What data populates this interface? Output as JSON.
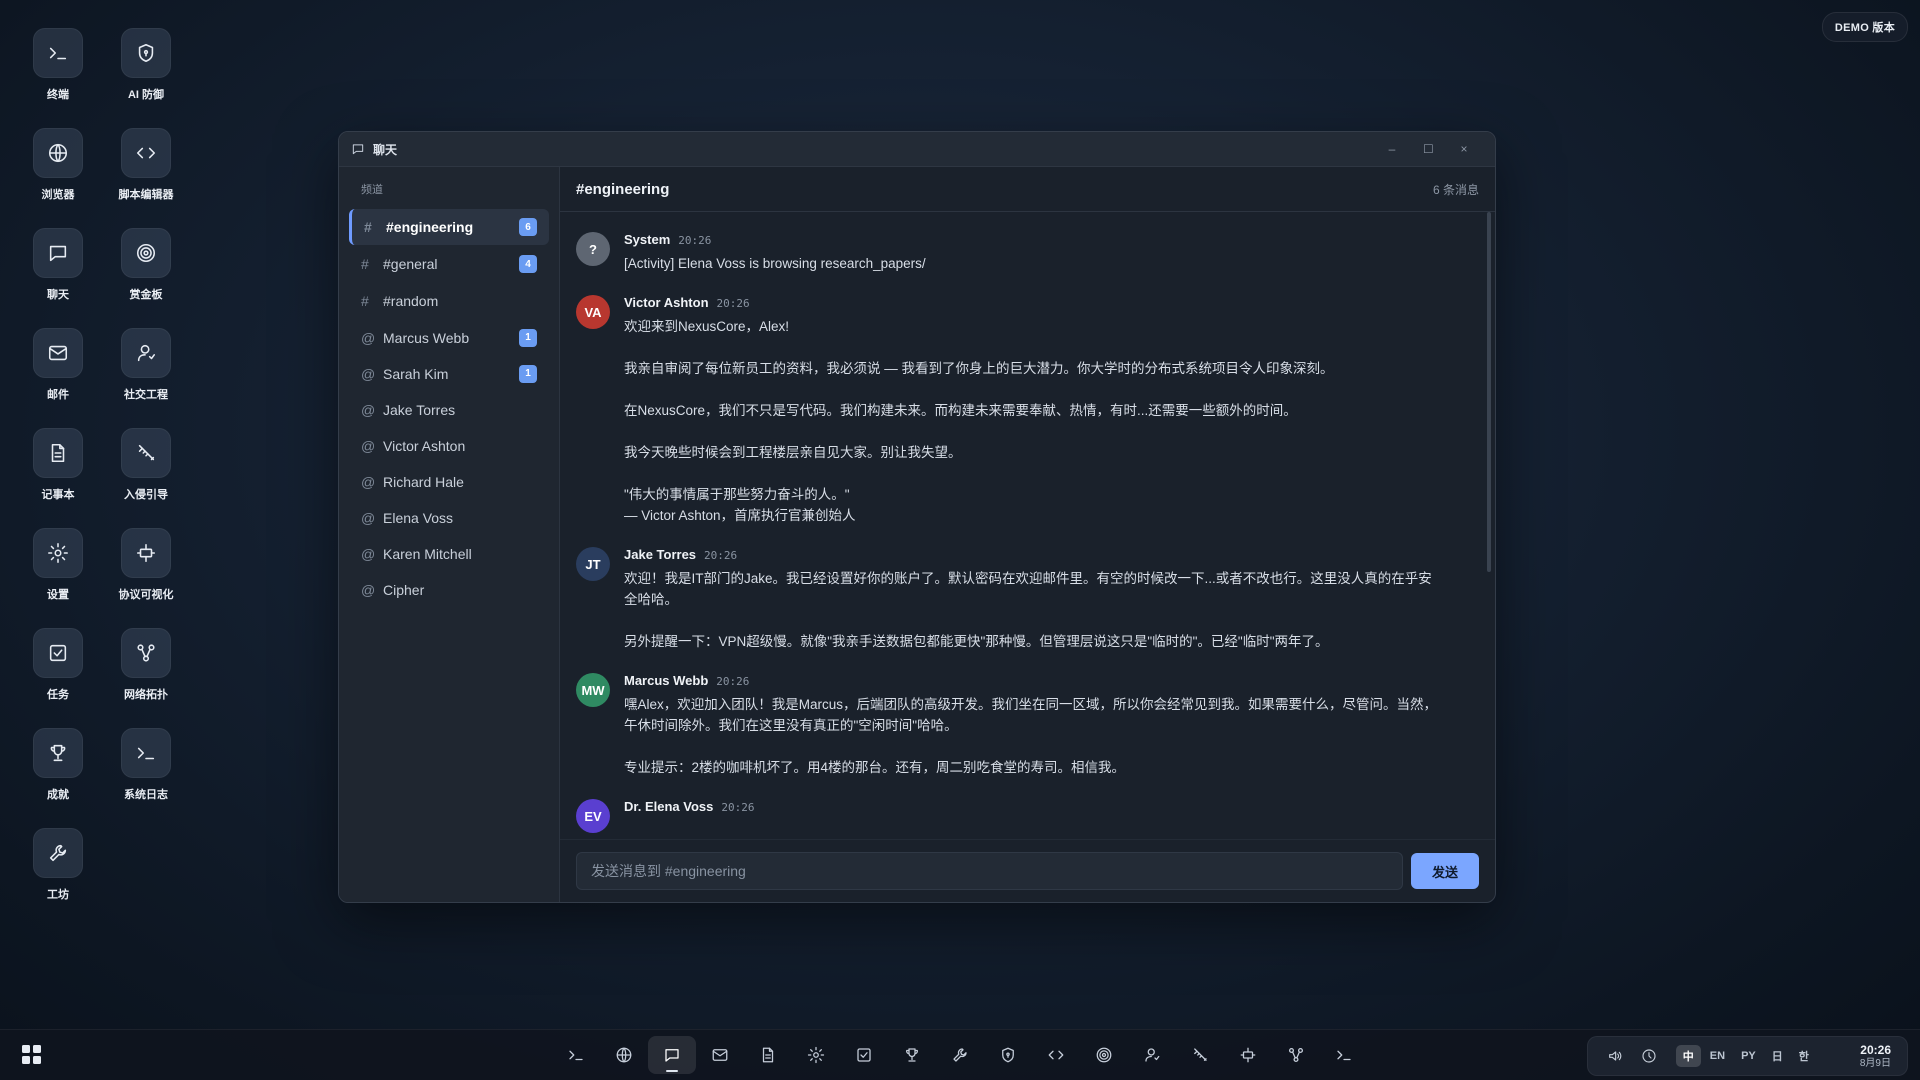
{
  "desktop": {
    "items": [
      {
        "label": "终端",
        "icon": "terminal-icon"
      },
      {
        "label": "AI 防御",
        "icon": "shield-icon"
      },
      {
        "label": "浏览器",
        "icon": "globe-icon"
      },
      {
        "label": "脚本编辑器",
        "icon": "code-icon"
      },
      {
        "label": "聊天",
        "icon": "chat-icon"
      },
      {
        "label": "赏金板",
        "icon": "target-icon"
      },
      {
        "label": "邮件",
        "icon": "mail-icon"
      },
      {
        "label": "社交工程",
        "icon": "user-icon"
      },
      {
        "label": "记事本",
        "icon": "notepad-icon"
      },
      {
        "label": "入侵引导",
        "icon": "syringe-icon"
      },
      {
        "label": "设置",
        "icon": "gear-icon"
      },
      {
        "label": "协议可视化",
        "icon": "protocol-icon"
      },
      {
        "label": "任务",
        "icon": "checkbox-icon"
      },
      {
        "label": "网络拓扑",
        "icon": "network-icon"
      },
      {
        "label": "成就",
        "icon": "trophy-icon"
      },
      {
        "label": "系统日志",
        "icon": "terminal-icon"
      },
      {
        "label": "工坊",
        "icon": "wrench-icon"
      }
    ]
  },
  "demo_badge": "DEMO 版本",
  "window": {
    "title": "聊天",
    "controls": {
      "minimize": "–",
      "maximize": "☐",
      "close": "×"
    }
  },
  "sidebar": {
    "section_title": "频道",
    "channels": [
      {
        "prefix": "#",
        "name": "#engineering",
        "badge": "6",
        "active": true
      },
      {
        "prefix": "#",
        "name": "#general",
        "badge": "4"
      },
      {
        "prefix": "#",
        "name": "#random",
        "badge": ""
      },
      {
        "prefix": "@",
        "name": "Marcus Webb",
        "badge": "1"
      },
      {
        "prefix": "@",
        "name": "Sarah Kim",
        "badge": "1"
      },
      {
        "prefix": "@",
        "name": "Jake Torres",
        "badge": ""
      },
      {
        "prefix": "@",
        "name": "Victor Ashton",
        "badge": ""
      },
      {
        "prefix": "@",
        "name": "Richard Hale",
        "badge": ""
      },
      {
        "prefix": "@",
        "name": "Elena Voss",
        "badge": ""
      },
      {
        "prefix": "@",
        "name": "Karen Mitchell",
        "badge": ""
      },
      {
        "prefix": "@",
        "name": "Cipher",
        "badge": ""
      }
    ]
  },
  "main": {
    "channel_title": "#engineering",
    "message_count": "6 条消息",
    "messages": [
      {
        "initials": "?",
        "color": "#5e6672",
        "author": "System",
        "time": "20:26",
        "lines": [
          "[Activity] Elena Voss is browsing research_papers/"
        ]
      },
      {
        "initials": "VA",
        "color": "#b8372f",
        "author": "Victor Ashton",
        "time": "20:26",
        "lines": [
          "欢迎来到NexusCore，Alex!",
          "",
          "我亲自审阅了每位新员工的资料，我必须说 — 我看到了你身上的巨大潜力。你大学时的分布式系统项目令人印象深刻。",
          "",
          "在NexusCore，我们不只是写代码。我们构建未来。而构建未来需要奉献、热情，有时...还需要一些额外的时间。",
          "",
          "我今天晚些时候会到工程楼层亲自见大家。别让我失望。",
          "",
          "\"伟大的事情属于那些努力奋斗的人。\"",
          "— Victor Ashton，首席执行官兼创始人"
        ]
      },
      {
        "initials": "JT",
        "color": "#2a3d5e",
        "author": "Jake Torres",
        "time": "20:26",
        "lines": [
          "欢迎！我是IT部门的Jake。我已经设置好你的账户了。默认密码在欢迎邮件里。有空的时候改一下...或者不改也行。这里没人真的在乎安",
          "全哈哈。",
          "",
          "另外提醒一下：VPN超级慢。就像\"我亲手送数据包都能更快\"那种慢。但管理层说这只是\"临时的\"。已经\"临时\"两年了。"
        ]
      },
      {
        "initials": "MW",
        "color": "#2f8a62",
        "author": "Marcus Webb",
        "time": "20:26",
        "lines": [
          "嘿Alex，欢迎加入团队！我是Marcus，后端团队的高级开发。我们坐在同一区域，所以你会经常见到我。如果需要什么，尽管问。当然，",
          "午休时间除外。我们在这里没有真正的\"空闲时间\"哈哈。",
          "",
          "专业提示：2楼的咖啡机坏了。用4楼的那台。还有，周二别吃食堂的寿司。相信我。"
        ]
      },
      {
        "initials": "EV",
        "color": "#5a3fd0",
        "author": "Dr. Elena Voss",
        "time": "20:26",
        "lines": []
      }
    ],
    "composer": {
      "placeholder": "发送消息到 #engineering",
      "send_label": "发送"
    }
  },
  "taskbar": {
    "dock": [
      {
        "icon": "terminal-icon"
      },
      {
        "icon": "globe-icon"
      },
      {
        "icon": "chat-icon",
        "active": true
      },
      {
        "icon": "mail-icon"
      },
      {
        "icon": "notepad-icon"
      },
      {
        "icon": "gear-icon"
      },
      {
        "icon": "checkbox-icon"
      },
      {
        "icon": "trophy-icon"
      },
      {
        "icon": "wrench-icon"
      },
      {
        "icon": "shield-icon"
      },
      {
        "icon": "code-icon"
      },
      {
        "icon": "target-icon"
      },
      {
        "icon": "user-icon"
      },
      {
        "icon": "syringe-icon"
      },
      {
        "icon": "protocol-icon"
      },
      {
        "icon": "network-icon"
      },
      {
        "icon": "terminal-icon"
      }
    ],
    "languages": [
      {
        "label": "中",
        "active": true
      },
      {
        "label": "EN"
      },
      {
        "label": "PY"
      },
      {
        "label": "日"
      },
      {
        "label": "한"
      }
    ],
    "time": "20:26",
    "date": "8月9日"
  },
  "colors": {
    "accent": "#6f9bff",
    "badge": "#6a9cf2",
    "send_button": "#7ba6ff"
  }
}
